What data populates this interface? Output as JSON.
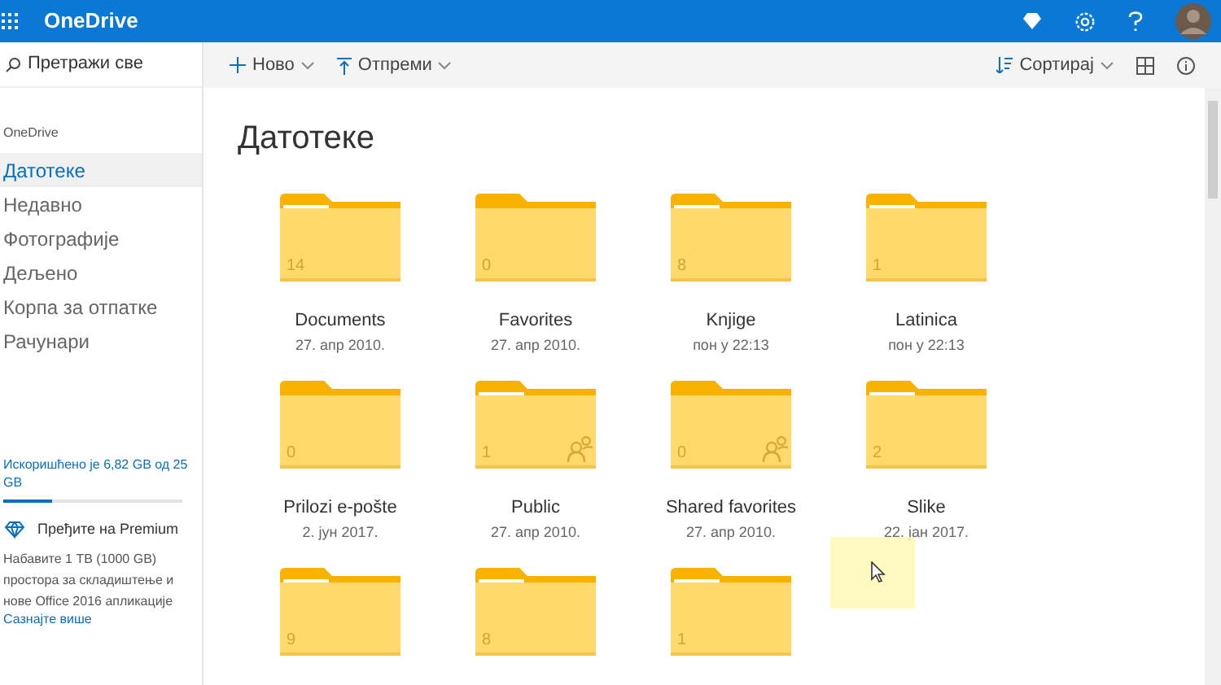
{
  "app_bar": {
    "title": "OneDrive"
  },
  "search": {
    "placeholder": "Претражи све"
  },
  "toolbar": {
    "left": [
      {
        "label": "Ново",
        "kind": "new"
      },
      {
        "label": "Отпреми",
        "kind": "upload"
      }
    ],
    "sort": "Сортирај"
  },
  "sidebar": {
    "heading": "OneDrive",
    "items": [
      {
        "label": "Датотеке",
        "selected": true
      },
      {
        "label": "Недавно",
        "selected": false
      },
      {
        "label": "Фотографије",
        "selected": false
      },
      {
        "label": "Дељено",
        "selected": false
      },
      {
        "label": "Корпа за отпатке",
        "selected": false
      },
      {
        "label": "Рачунари",
        "selected": false
      }
    ],
    "storage": {
      "text": "Искоришћено је 6,82 GB од 25 GB",
      "level": 0.27
    },
    "premium": {
      "title": "Пређите на Premium",
      "text": "Набавите 1 TB (1000 GB) простора за складиштење и нове Office 2016 апликације",
      "link": "Сазнајте више"
    }
  },
  "page_title": "Датотеке",
  "folders": [
    {
      "name": "Documents",
      "date": "27. апр 2010.",
      "count": "14",
      "has_items": true,
      "shared": false
    },
    {
      "name": "Favorites",
      "date": "27. апр 2010.",
      "count": "0",
      "has_items": false,
      "shared": false
    },
    {
      "name": "Knjige",
      "date": "пон у 22:13",
      "count": "8",
      "has_items": true,
      "shared": false
    },
    {
      "name": "Latinica",
      "date": "пон у 22:13",
      "count": "1",
      "has_items": true,
      "shared": false
    },
    {
      "name": "Prilozi e-pošte",
      "date": "2. јун 2017.",
      "count": "0",
      "has_items": false,
      "shared": false
    },
    {
      "name": "Public",
      "date": "27. апр 2010.",
      "count": "1",
      "has_items": true,
      "shared": true
    },
    {
      "name": "Shared favorites",
      "date": "27. апр 2010.",
      "count": "0",
      "has_items": false,
      "shared": true
    },
    {
      "name": "Slike",
      "date": "22. јан 2017.",
      "count": "2",
      "has_items": true,
      "shared": false
    },
    {
      "count": "9",
      "has_items": true,
      "shared": false
    },
    {
      "count": "8",
      "has_items": true,
      "shared": false
    },
    {
      "count": "1",
      "has_items": true,
      "shared": false
    }
  ]
}
